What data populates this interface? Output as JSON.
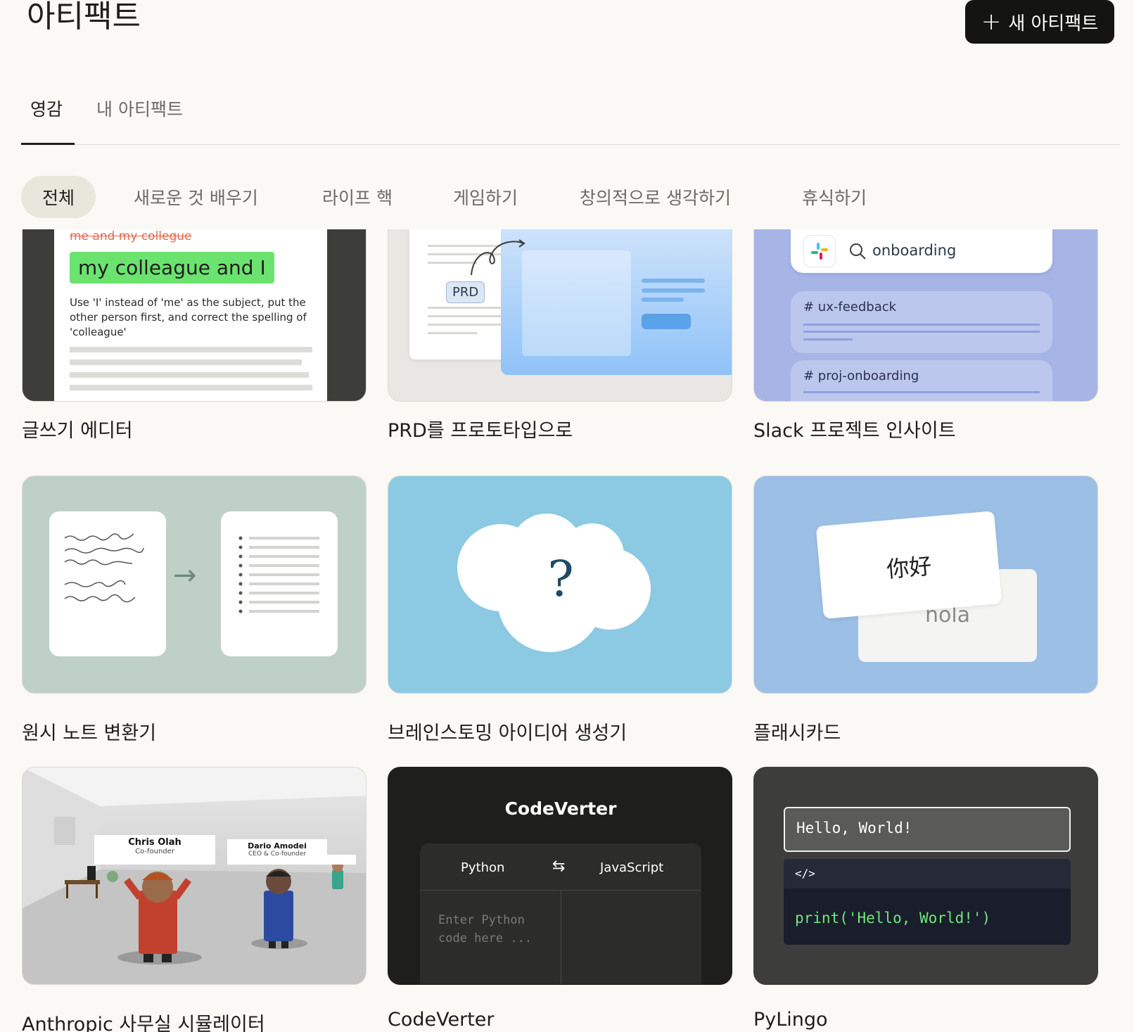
{
  "header": {
    "title": "아티팩트",
    "new_button_label": "새 아티팩트"
  },
  "tabs": [
    {
      "label": "영감",
      "active": true
    },
    {
      "label": "내 아티팩트",
      "active": false
    }
  ],
  "categories": [
    {
      "label": "전체",
      "active": true
    },
    {
      "label": "새로운 것 배우기",
      "active": false
    },
    {
      "label": "라이프 핵",
      "active": false
    },
    {
      "label": "게임하기",
      "active": false
    },
    {
      "label": "창의적으로 생각하기",
      "active": false
    },
    {
      "label": "휴식하기",
      "active": false
    }
  ],
  "cards": [
    {
      "title": "글쓰기 에디터",
      "preview": {
        "strike": "me and my collegue",
        "suggestion": "my colleague and I",
        "note": "Use 'I' instead of 'me' as the subject, put the other person first, and correct the spelling of 'colleague'"
      }
    },
    {
      "title": "PRD를 프로토타입으로",
      "preview": {
        "badge": "PRD"
      }
    },
    {
      "title": "Slack 프로젝트 인사이트",
      "preview": {
        "search": "onboarding",
        "channel1": "# ux-feedback",
        "channel2": "# proj-onboarding"
      }
    },
    {
      "title": "원시 노트 변환기"
    },
    {
      "title": "브레인스토밍 아이디어 생성기",
      "preview": {
        "symbol": "?"
      }
    },
    {
      "title": "플래시카드",
      "preview": {
        "front": "你好",
        "back": "hola"
      }
    },
    {
      "title": "Anthropic 사무실 시뮬레이터",
      "preview": {
        "name1": "Chris Olah",
        "role1": "Co-founder",
        "name2": "Dario Amodei",
        "role2": "CEO & Co-founder"
      }
    },
    {
      "title": "CodeVerter",
      "preview": {
        "heading": "CodeVerter",
        "from": "Python",
        "swap": "⇆",
        "to": "JavaScript",
        "placeholder": "Enter Python code here ..."
      }
    },
    {
      "title": "PyLingo",
      "preview": {
        "output": "Hello, World!",
        "code_tag": "</>",
        "code": "print('Hello, World!')"
      }
    }
  ]
}
